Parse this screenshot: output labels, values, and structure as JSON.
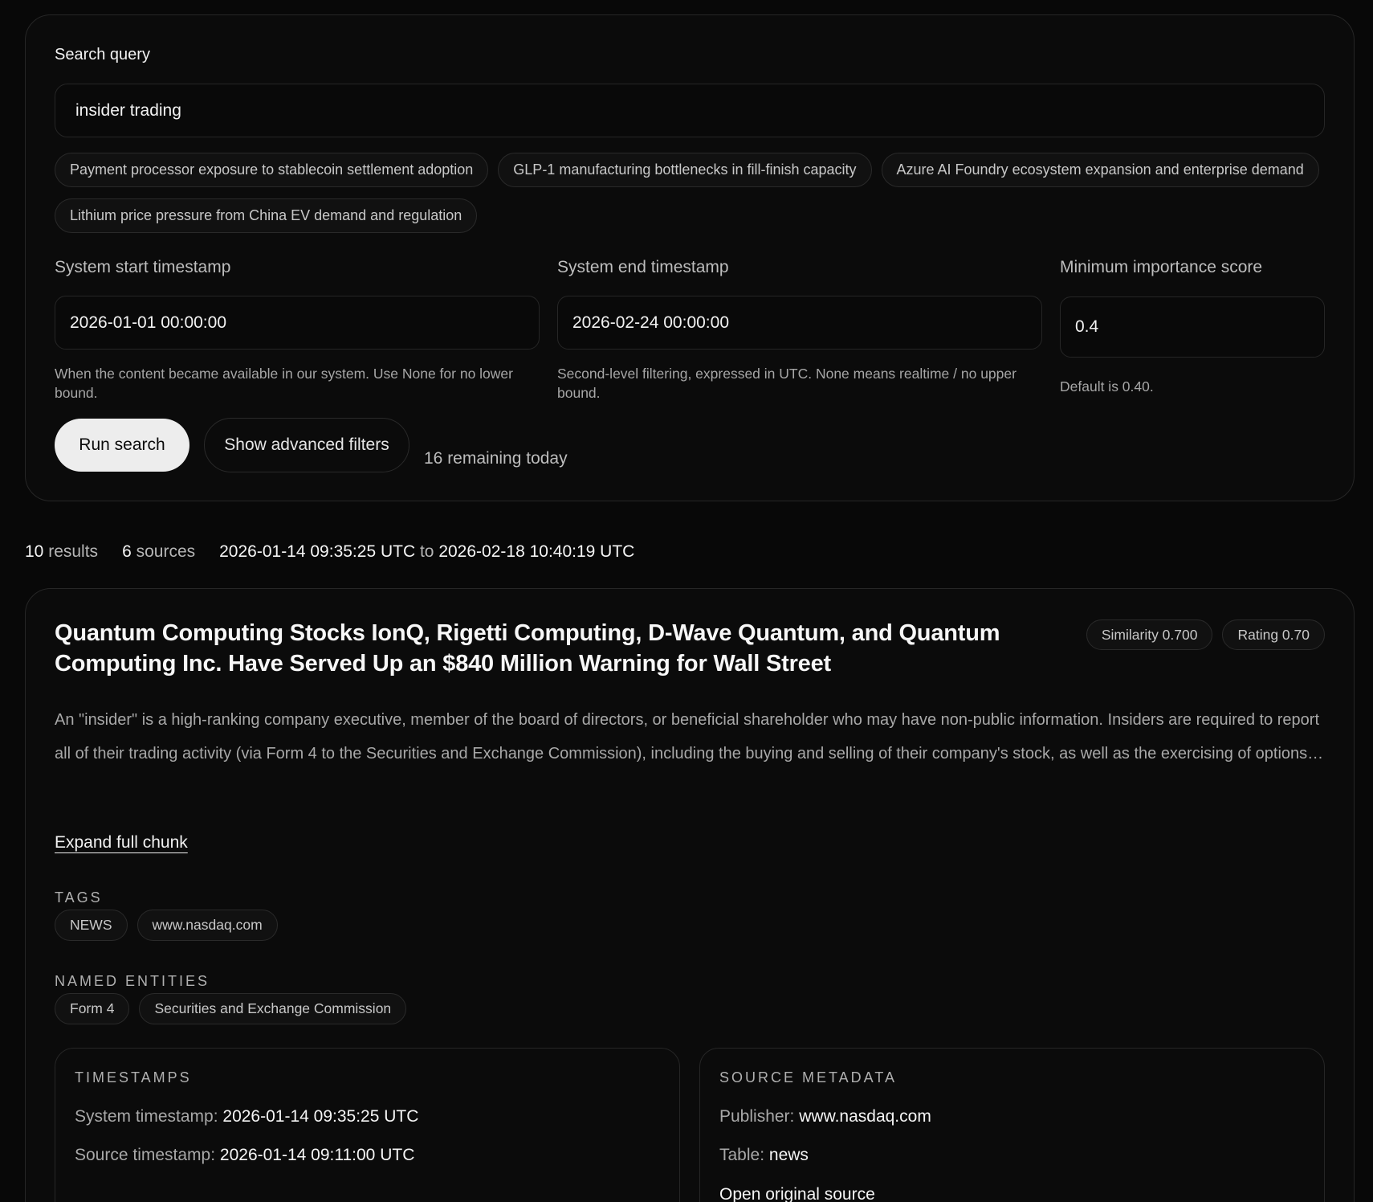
{
  "search": {
    "label": "Search query",
    "value": "insider trading",
    "suggestions": [
      "Payment processor exposure to stablecoin settlement adoption",
      "GLP-1 manufacturing bottlenecks in fill-finish capacity",
      "Azure AI Foundry ecosystem expansion and enterprise demand",
      "Lithium price pressure from China EV demand and regulation"
    ],
    "start": {
      "label": "System start timestamp",
      "value": "2026-01-01 00:00:00",
      "hint": "When the content became available in our system. Use None for no lower bound."
    },
    "end": {
      "label": "System end timestamp",
      "value": "2026-02-24 00:00:00",
      "hint": "Second-level filtering, expressed in UTC. None means realtime / no upper bound."
    },
    "min_score": {
      "label": "Minimum importance score",
      "value": "0.4",
      "hint": "Default is 0.40."
    },
    "run_label": "Run search",
    "advanced_label": "Show advanced filters",
    "remaining": "16 remaining today"
  },
  "summary": {
    "results_count": "10",
    "results_label": "results",
    "sources_count": "6",
    "sources_label": "sources",
    "range_start": "2026-01-14 09:35:25 UTC",
    "range_to": "to",
    "range_end": "2026-02-18 10:40:19 UTC"
  },
  "result": {
    "title": "Quantum Computing Stocks IonQ, Rigetti Computing, D-Wave Quantum, and Quantum Computing Inc. Have Served Up an $840 Million Warning for Wall Street",
    "similarity": "Similarity 0.700",
    "rating": "Rating 0.70",
    "snippet": "An \"insider\" is a high-ranking company executive, member of the board of directors, or beneficial shareholder who may have non-public information. Insiders are required to report all of their trading activity (via Form 4 to the Securities and Exchange Commission), including the buying and selling of their company's stock, as well as the exercising of options…",
    "expand_label": "Expand full chunk",
    "tags_heading": "TAGS",
    "tags": [
      "NEWS",
      "www.nasdaq.com"
    ],
    "entities_heading": "NAMED ENTITIES",
    "entities": [
      "Form 4",
      "Securities and Exchange Commission"
    ],
    "timestamps": {
      "heading": "TIMESTAMPS",
      "system_label": "System timestamp:",
      "system_value": "2026-01-14 09:35:25 UTC",
      "source_label": "Source timestamp:",
      "source_value": "2026-01-14 09:11:00 UTC"
    },
    "source_meta": {
      "heading": "SOURCE METADATA",
      "publisher_label": "Publisher:",
      "publisher_value": "www.nasdaq.com",
      "table_label": "Table:",
      "table_value": "news",
      "open_label": "Open original source"
    }
  }
}
